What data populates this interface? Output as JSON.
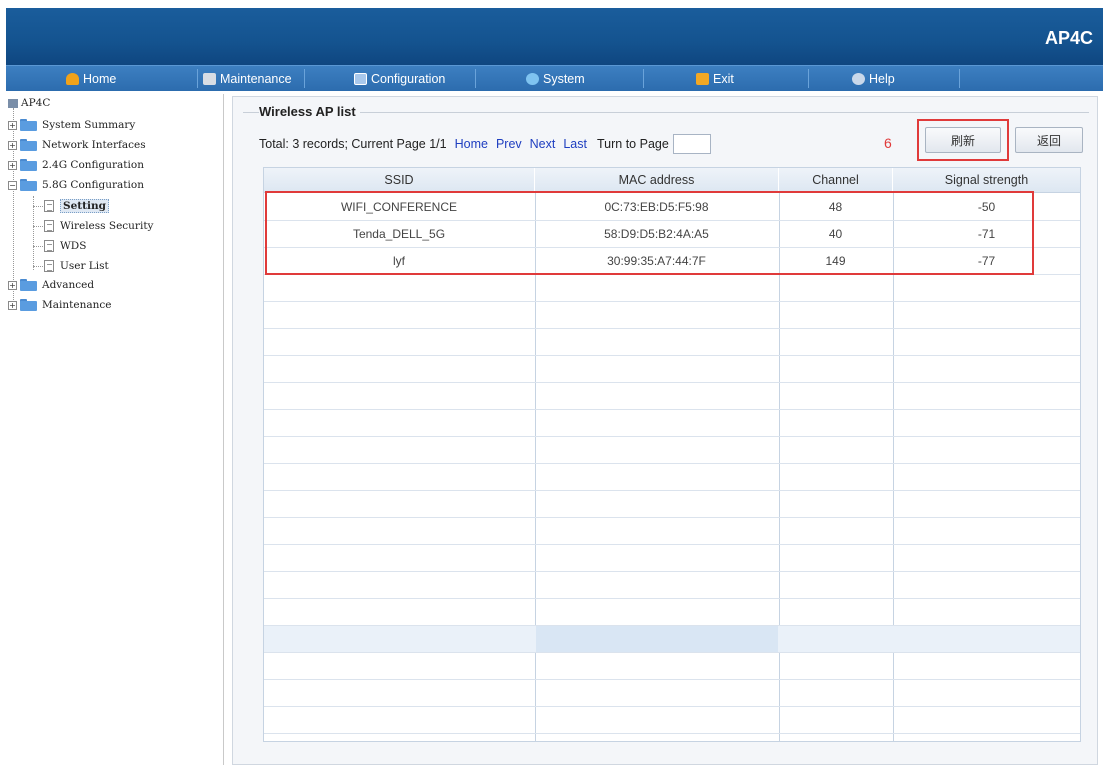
{
  "header": {
    "brand": "AP4C"
  },
  "nav": [
    {
      "label": "Home",
      "icon": "home-icon"
    },
    {
      "label": "Maintenance",
      "icon": "tools-icon"
    },
    {
      "label": "Configuration",
      "icon": "monitor-icon"
    },
    {
      "label": "System",
      "icon": "system-icon"
    },
    {
      "label": "Exit",
      "icon": "exit-icon"
    },
    {
      "label": "Help",
      "icon": "help-icon"
    }
  ],
  "sidebar": {
    "root": "AP4C",
    "items": [
      {
        "label": "System Summary"
      },
      {
        "label": "Network Interfaces"
      },
      {
        "label": "2.4G Configuration"
      },
      {
        "label": "5.8G Configuration"
      },
      {
        "label": "Setting"
      },
      {
        "label": "Wireless Security"
      },
      {
        "label": "WDS"
      },
      {
        "label": "User List"
      },
      {
        "label": "Advanced"
      },
      {
        "label": "Maintenance"
      }
    ]
  },
  "panel": {
    "title": "Wireless AP list",
    "summary": "Total: 3 records; Current Page 1/1",
    "links": {
      "home": "Home",
      "prev": "Prev",
      "next": "Next",
      "last": "Last"
    },
    "turn_to_page": "Turn to Page",
    "page_value": "",
    "annotation": "6",
    "refresh_label": "刷新",
    "back_label": "返回"
  },
  "table": {
    "columns": [
      "SSID",
      "MAC address",
      "Channel",
      "Signal strength"
    ],
    "rows": [
      [
        "WIFI_CONFERENCE",
        "0C:73:EB:D5:F5:98",
        "48",
        "-50"
      ],
      [
        "Tenda_DELL_5G",
        "58:D9:D5:B2:4A:A5",
        "40",
        "-71"
      ],
      [
        "lyf",
        "30:99:35:A7:44:7F",
        "149",
        "-77"
      ]
    ]
  },
  "colors": {
    "header": "#14538f",
    "nav": "#2c6cae",
    "highlight": "#e03a3a",
    "link": "#1e3ec0"
  }
}
